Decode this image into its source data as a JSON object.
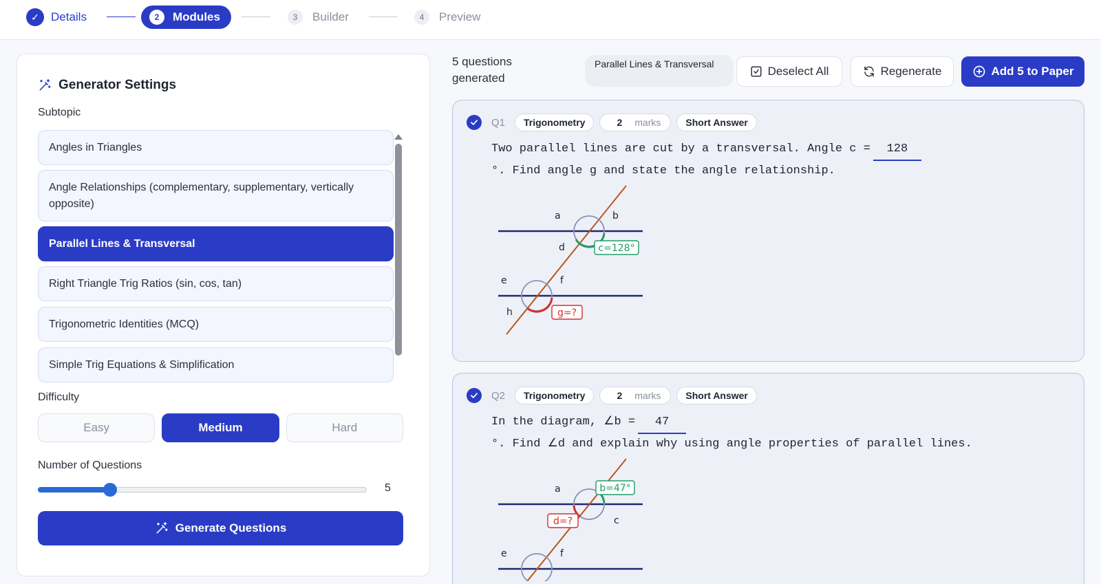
{
  "stepper": {
    "steps": [
      {
        "num": "✓",
        "label": "Details"
      },
      {
        "num": "2",
        "label": "Modules"
      },
      {
        "num": "3",
        "label": "Builder"
      },
      {
        "num": "4",
        "label": "Preview"
      }
    ]
  },
  "settings": {
    "title": "Generator Settings",
    "subtopic_label": "Subtopic",
    "subtopics": [
      "Angles in Triangles",
      "Angle Relationships (complementary, supplementary, vertically opposite)",
      "Parallel Lines & Transversal",
      "Right Triangle Trig Ratios (sin, cos, tan)",
      "Trigonometric Identities (MCQ)",
      "Simple Trig Equations & Simplification"
    ],
    "selected_subtopic": "Parallel Lines & Transversal",
    "difficulty_label": "Difficulty",
    "difficulties": [
      "Easy",
      "Medium",
      "Hard"
    ],
    "selected_difficulty": "Medium",
    "num_questions_label": "Number of Questions",
    "num_questions": "5",
    "slider_fraction": 0.22,
    "generate_label": "Generate Questions"
  },
  "results": {
    "count_text": "5 questions generated",
    "topic_chip": "Parallel Lines & Transversal",
    "deselect_label": "Deselect All",
    "regenerate_label": "Regenerate",
    "add_label": "Add 5 to Paper"
  },
  "questions": [
    {
      "id": "Q1",
      "topic": "Trigonometry",
      "marks_num": "2",
      "marks_unit": "marks",
      "type": "Short Answer",
      "text_before": "Two parallel lines are cut by a transversal. Angle c =",
      "blank_value": "128",
      "text_after": "°. Find angle g and state the angle relationship.",
      "diagram": {
        "top_labels": [
          "a",
          "b",
          "d"
        ],
        "bottom_labels": [
          "e",
          "f",
          "h"
        ],
        "known": "c=128°",
        "unknown": "g=?"
      }
    },
    {
      "id": "Q2",
      "topic": "Trigonometry",
      "marks_num": "2",
      "marks_unit": "marks",
      "type": "Short Answer",
      "text_before": "In the diagram, ∠b =",
      "blank_value": "47",
      "text_after": "°. Find ∠d and explain why using angle properties of parallel lines.",
      "diagram": {
        "top_labels": [
          "a",
          "c"
        ],
        "bottom_labels": [
          "e",
          "f"
        ],
        "known": "b=47°",
        "unknown": "d=?"
      }
    }
  ],
  "colors": {
    "primary": "#2a3cc6",
    "transversal": "#b8561a",
    "known_angle": "#1f9d6a",
    "unknown_angle": "#d62f2f"
  }
}
